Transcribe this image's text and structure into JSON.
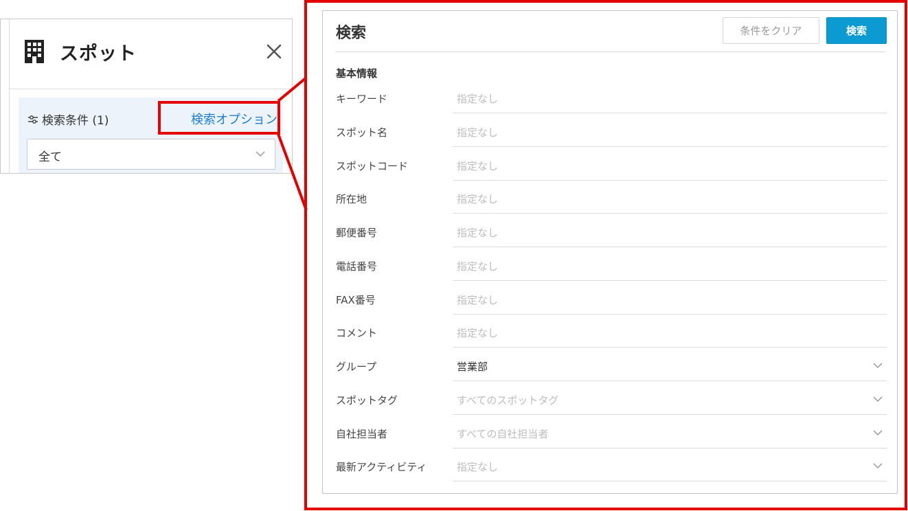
{
  "left_panel": {
    "title": "スポット",
    "filter_label": "検索条件 (1)",
    "options_link": "検索オプション",
    "scope_select": "全て"
  },
  "dialog": {
    "title": "検索",
    "clear_button": "条件をクリア",
    "search_button": "検索",
    "section_title": "基本情報",
    "fields": [
      {
        "label": "キーワード",
        "value": "",
        "placeholder": "指定なし",
        "type": "text"
      },
      {
        "label": "スポット名",
        "value": "",
        "placeholder": "指定なし",
        "type": "text"
      },
      {
        "label": "スポットコード",
        "value": "",
        "placeholder": "指定なし",
        "type": "text"
      },
      {
        "label": "所在地",
        "value": "",
        "placeholder": "指定なし",
        "type": "text"
      },
      {
        "label": "郵便番号",
        "value": "",
        "placeholder": "指定なし",
        "type": "text"
      },
      {
        "label": "電話番号",
        "value": "",
        "placeholder": "指定なし",
        "type": "text"
      },
      {
        "label": "FAX番号",
        "value": "",
        "placeholder": "指定なし",
        "type": "text"
      },
      {
        "label": "コメント",
        "value": "",
        "placeholder": "指定なし",
        "type": "text"
      },
      {
        "label": "グループ",
        "value": "営業部",
        "placeholder": "",
        "type": "select"
      },
      {
        "label": "スポットタグ",
        "value": "",
        "placeholder": "すべてのスポットタグ",
        "type": "select"
      },
      {
        "label": "自社担当者",
        "value": "",
        "placeholder": "すべての自社担当者",
        "type": "select"
      },
      {
        "label": "最新アクティビティ",
        "value": "",
        "placeholder": "指定なし",
        "type": "select"
      }
    ]
  },
  "colors": {
    "accent": "#0b9ad1",
    "link": "#1d7fd6",
    "highlight": "#e50000",
    "filter_bg": "#edf3fa"
  }
}
